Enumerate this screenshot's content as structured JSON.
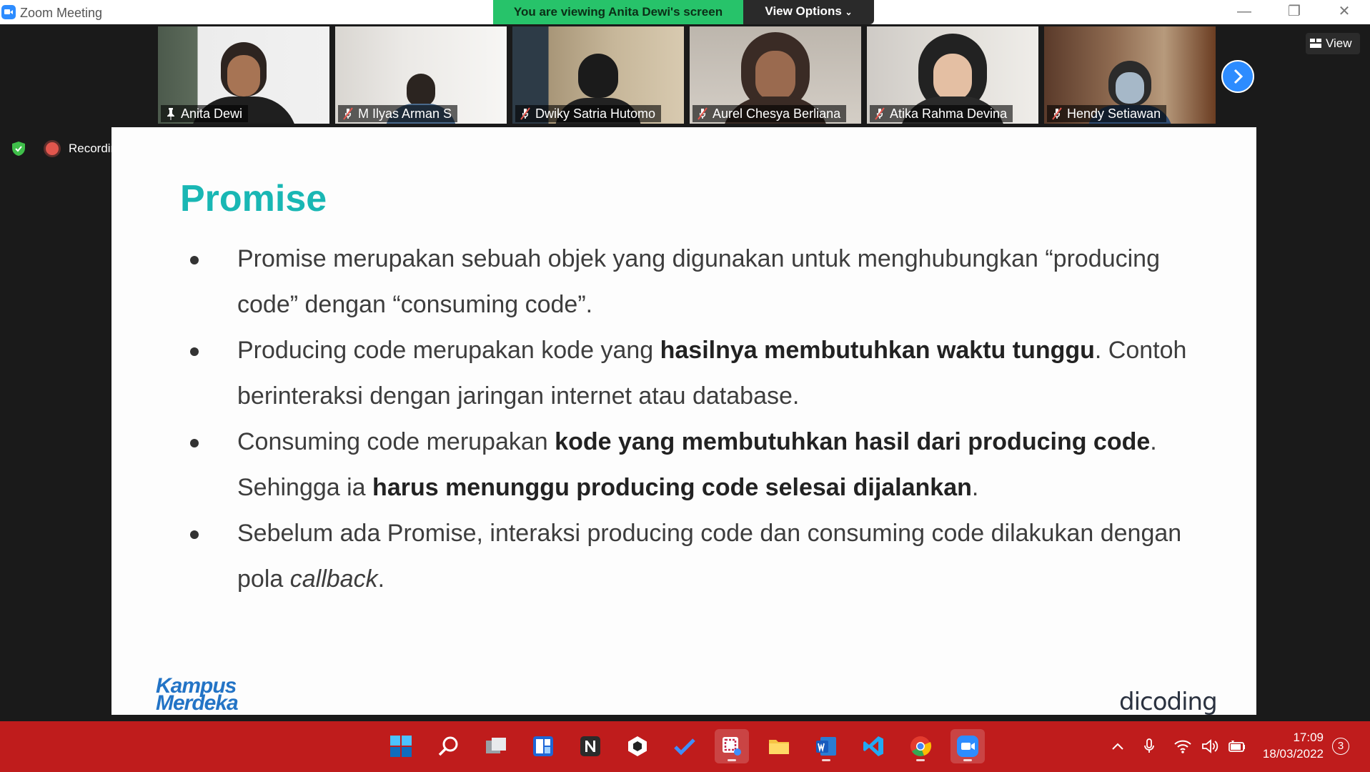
{
  "window": {
    "title": "Zoom Meeting"
  },
  "banner": {
    "viewing_text": "You are viewing Anita Dewi's screen",
    "view_options_label": "View Options"
  },
  "view_button_label": "View",
  "recording_label": "Recording",
  "participants": [
    {
      "name": "Anita Dewi",
      "pinned": true,
      "muted": false
    },
    {
      "name": "M Ilyas Arman S",
      "pinned": false,
      "muted": true
    },
    {
      "name": "Dwiky Satria Hutomo",
      "pinned": false,
      "muted": true
    },
    {
      "name": "Aurel Chesya Berliana",
      "pinned": false,
      "muted": true
    },
    {
      "name": "Atika Rahma Devina",
      "pinned": false,
      "muted": true
    },
    {
      "name": "Hendy Setiawan",
      "pinned": false,
      "muted": true
    }
  ],
  "slide": {
    "title": "Promise",
    "bullets": [
      {
        "parts": [
          {
            "t": "Promise merupakan sebuah objek yang digunakan untuk menghubungkan “producing code” dengan “consuming code”."
          }
        ]
      },
      {
        "parts": [
          {
            "t": "Producing code merupakan kode yang "
          },
          {
            "t": "hasilnya membutuhkan waktu tunggu",
            "s": "b"
          },
          {
            "t": ". Contoh berinteraksi dengan jaringan internet atau database."
          }
        ]
      },
      {
        "parts": [
          {
            "t": "Consuming code merupakan "
          },
          {
            "t": "kode yang membutuhkan hasil dari producing code",
            "s": "b"
          },
          {
            "t": ". Sehingga ia "
          },
          {
            "t": "harus menunggu producing code selesai dijalankan",
            "s": "b"
          },
          {
            "t": "."
          }
        ]
      },
      {
        "parts": [
          {
            "t": "Sebelum ada Promise, interaksi producing code dan consuming code dilakukan dengan pola "
          },
          {
            "t": "callback",
            "s": "i"
          },
          {
            "t": "."
          }
        ]
      }
    ],
    "logo_left_line1": "Kampus",
    "logo_left_line2": "Merdeka",
    "logo_right": "dicoding"
  },
  "taskbar": {
    "apps": [
      "start",
      "search",
      "task-view",
      "widgets",
      "notion",
      "unity",
      "todo",
      "snipping-tool",
      "file-explorer",
      "word",
      "vscode",
      "chrome",
      "zoom"
    ],
    "time": "17:09",
    "date": "18/03/2022",
    "notification_count": "3"
  },
  "colors": {
    "accent": "#19b7b4",
    "banner": "#27c36a",
    "taskbar": "#bf1c1c",
    "zoom_blue": "#2d8cff"
  }
}
